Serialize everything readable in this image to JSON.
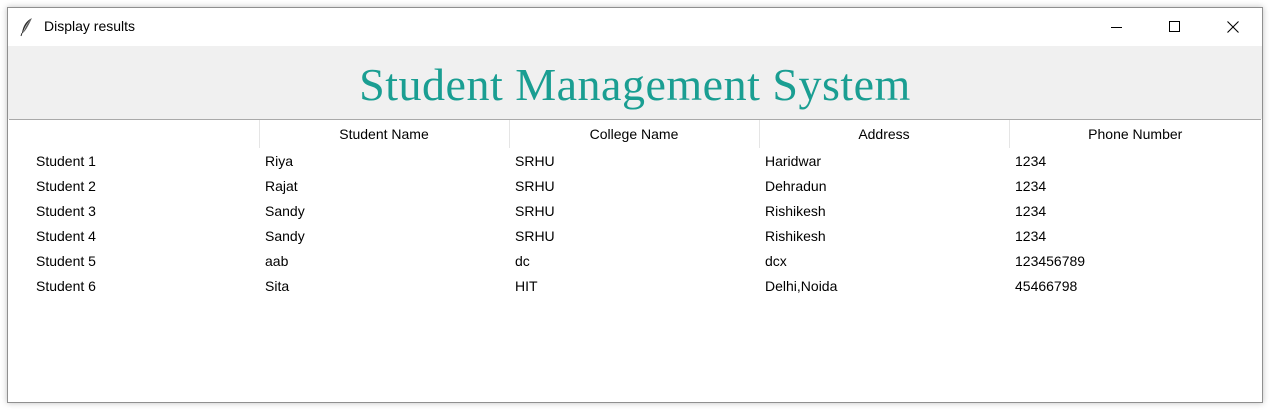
{
  "window": {
    "title": "Display results",
    "icon": "feather-icon"
  },
  "header": {
    "title": "Student Management System",
    "title_color": "#1a9e92",
    "background": "#f0f0f0"
  },
  "table": {
    "columns": [
      "",
      "Student Name",
      "College Name",
      "Address",
      "Phone Number"
    ],
    "rows": [
      [
        "Student 1",
        "Riya",
        "SRHU",
        "Haridwar",
        "1234"
      ],
      [
        "Student 2",
        "Rajat",
        "SRHU",
        "Dehradun",
        "1234"
      ],
      [
        "Student 3",
        "Sandy",
        "SRHU",
        "Rishikesh",
        "1234"
      ],
      [
        "Student 4",
        "Sandy",
        "SRHU",
        "Rishikesh",
        "1234"
      ],
      [
        "Student 5",
        "aab",
        "dc",
        "dcx",
        "123456789"
      ],
      [
        "Student 6",
        "Sita",
        "HIT",
        "Delhi,Noida",
        "45466798"
      ]
    ]
  }
}
